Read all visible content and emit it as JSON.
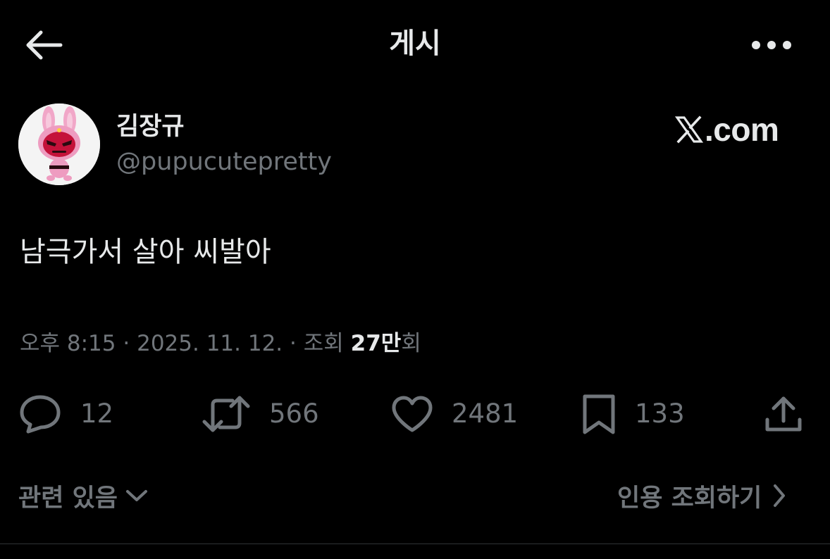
{
  "header": {
    "title": "게시"
  },
  "author": {
    "display_name": "김장규",
    "handle": "@pupucutepretty"
  },
  "watermark": {
    "text": ".com"
  },
  "tweet": {
    "text": "남극가서 살아 씨발아"
  },
  "meta": {
    "time": "오후 8:15",
    "date": "2025. 11. 12.",
    "views_label_prefix": "조회",
    "views_count": "27만",
    "views_label_suffix": "회"
  },
  "actions": {
    "replies": "12",
    "reposts": "566",
    "likes": "2481",
    "bookmarks": "133"
  },
  "footer": {
    "related_label": "관련 있음",
    "quotes_label": "인용 조회하기"
  },
  "icons": {
    "back": "arrow-left-icon",
    "more": "more-horizontal-icon",
    "reply": "speech-bubble-icon",
    "repost": "repost-arrows-icon",
    "like": "heart-icon",
    "bookmark": "bookmark-icon",
    "share": "share-upload-icon",
    "related": "chevron-down-icon",
    "quotes": "chevron-right-icon"
  },
  "colors": {
    "background": "#000000",
    "primary_text": "#e7e9ea",
    "secondary_text": "#71767b",
    "divider": "#2f3336"
  }
}
